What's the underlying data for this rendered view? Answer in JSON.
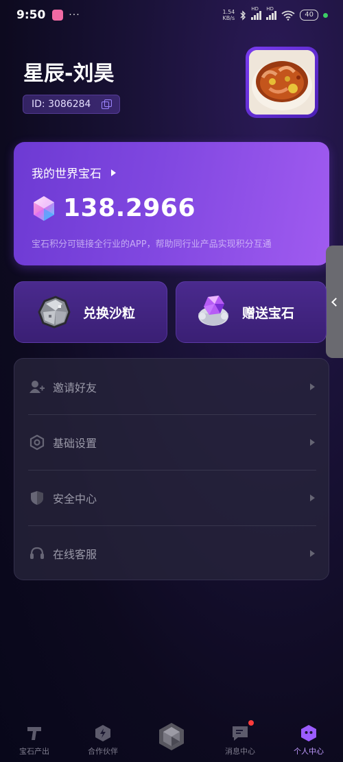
{
  "status_bar": {
    "time": "9:50",
    "dots": "···",
    "net_speed_value": "1.54",
    "net_speed_unit": "KB/s",
    "battery": "40",
    "sim_label": "HD"
  },
  "profile": {
    "username": "星辰-刘昊",
    "id_text": "ID: 3086284"
  },
  "gem_card": {
    "title": "我的世界宝石",
    "value": "138.2966",
    "description": "宝石积分可链接全行业的APP，帮助同行业产品实现积分互通"
  },
  "actions": {
    "exchange_label": "兑换沙粒",
    "gift_label": "赠送宝石"
  },
  "menu": [
    {
      "label": "邀请好友",
      "icon": "add-user-icon"
    },
    {
      "label": "基础设置",
      "icon": "settings-icon"
    },
    {
      "label": "安全中心",
      "icon": "shield-icon"
    },
    {
      "label": "在线客服",
      "icon": "headset-icon"
    }
  ],
  "bottom_nav": [
    {
      "label": "宝石产出",
      "icon": "gem-output-icon"
    },
    {
      "label": "合作伙伴",
      "icon": "partner-icon"
    },
    {
      "label": "",
      "icon": "center-gem-icon"
    },
    {
      "label": "消息中心",
      "icon": "message-icon"
    },
    {
      "label": "个人中心",
      "icon": "profile-icon",
      "active": true
    }
  ],
  "colors": {
    "accent": "#8047e0",
    "active_nav": "#c09bff",
    "notification": "#ff3b3b"
  }
}
